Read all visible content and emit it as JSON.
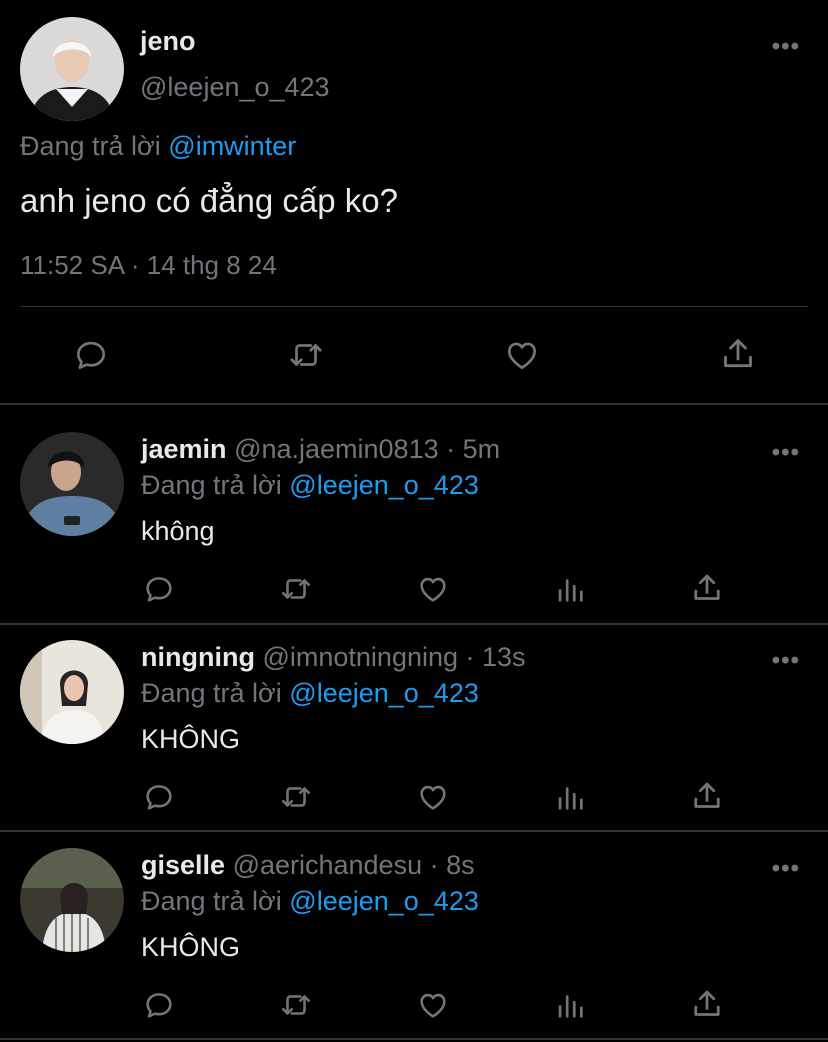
{
  "main_tweet": {
    "name": "jeno",
    "handle": "@leejen_o_423",
    "reply_prefix": "Đang trả lời",
    "reply_mention": "@imwinter",
    "text": "anh jeno có đẳng cấp ko?",
    "timestamp": "11:52 SA · 14 thg 8 24",
    "more_label": "•••",
    "actions": [
      "reply-icon",
      "retweet-icon",
      "like-icon",
      "share-icon"
    ]
  },
  "replies": [
    {
      "name": "jaemin",
      "handle": "@na.jaemin0813 · 5m",
      "reply_prefix": "Đang trả lời",
      "reply_mention": "@leejen_o_423",
      "text": "không",
      "more_label": "•••"
    },
    {
      "name": "ningning",
      "handle": "@imnotningning · 13s",
      "reply_prefix": "Đang trả lời",
      "reply_mention": "@leejen_o_423",
      "text": "KHÔNG",
      "more_label": "•••"
    },
    {
      "name": "giselle",
      "handle": "@aerichandesu · 8s",
      "reply_prefix": "Đang trả lời",
      "reply_mention": "@leejen_o_423",
      "text": "KHÔNG",
      "more_label": "•••"
    }
  ],
  "reply_actions": [
    "reply-icon",
    "retweet-icon",
    "like-icon",
    "analytics-icon",
    "share-icon"
  ],
  "colors": {
    "background": "#000000",
    "text": "#e7e9ea",
    "secondary": "#71767b",
    "link": "#1d9bf0",
    "divider": "#2f3336"
  }
}
